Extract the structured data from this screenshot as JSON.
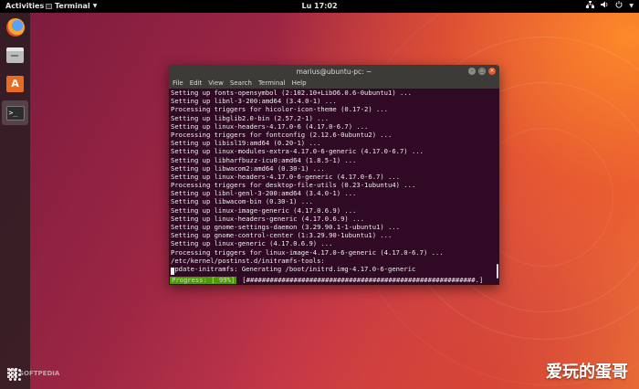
{
  "topbar": {
    "activities": "Activities",
    "app_name": "Terminal",
    "clock": "Lu 17:02",
    "tray_icons": [
      "network-icon",
      "volume-icon",
      "power-icon",
      "chevron-down-icon"
    ]
  },
  "dock": {
    "items": [
      {
        "name": "firefox",
        "icon": "firefox-icon"
      },
      {
        "name": "files",
        "icon": "files-icon"
      },
      {
        "name": "software",
        "icon": "software-center-icon",
        "glyph": "A"
      },
      {
        "name": "terminal",
        "icon": "terminal-icon",
        "glyph": ">_",
        "active": true
      }
    ],
    "apps_icon": "show-applications-icon"
  },
  "terminal": {
    "title": "marius@ubuntu-pc: ~",
    "menu": [
      "File",
      "Edit",
      "View",
      "Search",
      "Terminal",
      "Help"
    ],
    "lines": [
      "Setting up fonts-opensymbol (2:102.10+LibO6.0.6-0ubuntu1) ...",
      "Setting up libnl-3-200:amd64 (3.4.0-1) ...",
      "Processing triggers for hicolor-icon-theme (0.17-2) ...",
      "Setting up libglib2.0-bin (2.57.2-1) ...",
      "Setting up linux-headers-4.17.0-6 (4.17.0-6.7) ...",
      "Processing triggers for fontconfig (2.12.6-0ubuntu2) ...",
      "Setting up libisl19:amd64 (0.20-1) ...",
      "Setting up linux-modules-extra-4.17.0-6-generic (4.17.0-6.7) ...",
      "Setting up libharfbuzz-icu0:amd64 (1.8.5-1) ...",
      "Setting up libwacom2:amd64 (0.30-1) ...",
      "Setting up linux-headers-4.17.0-6-generic (4.17.0-6.7) ...",
      "Processing triggers for desktop-file-utils (0.23-1ubuntu4) ...",
      "Setting up libnl-genl-3-200:amd64 (3.4.0-1) ...",
      "Setting up libwacom-bin (0.30-1) ...",
      "Setting up linux-image-generic (4.17.0.6.9) ...",
      "Setting up linux-headers-generic (4.17.0.6.9) ...",
      "Setting up gnome-settings-daemon (3.29.90.1-1-ubuntu1) ...",
      "Setting up gnome-control-center (1:3.29.90-1ubuntu1) ...",
      "Setting up linux-generic (4.17.0.6.9) ...",
      "Processing triggers for linux-image-4.17.0-6-generic (4.17.0-6.7) ...",
      "/etc/kernel/postinst.d/initramfs-tools:",
      "update-initramfs: Generating /boot/initrd.img-4.17.0-6-generic"
    ],
    "progress_label": "Progress: [ 99%]",
    "progress_bar": "[##########################################################.]",
    "progress_percent": 99
  },
  "watermarks": {
    "softpedia": "SOFTPEDIA",
    "cn": "爱玩的蛋哥"
  }
}
